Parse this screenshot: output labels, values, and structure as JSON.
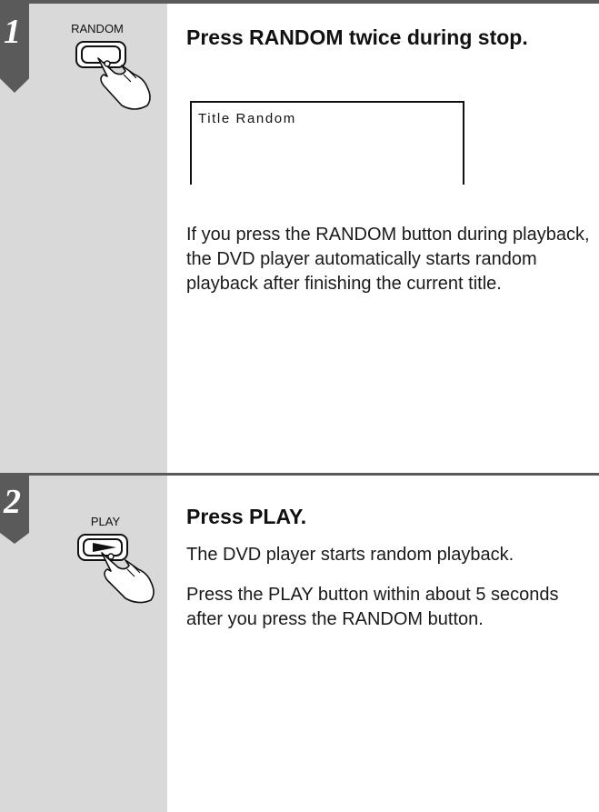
{
  "step1": {
    "number": "1",
    "button_label": "RANDOM",
    "heading": "Press RANDOM twice during stop.",
    "display_text": "Title Random",
    "body": "If you press the RANDOM button during playback, the DVD player automatically starts random playback after finishing the current title."
  },
  "step2": {
    "number": "2",
    "button_label": "PLAY",
    "heading": "Press PLAY.",
    "body1": "The DVD player starts random playback.",
    "body2": "Press the PLAY button within about 5 seconds after you press the RANDOM button."
  },
  "colors": {
    "sidebar": "#d9d9d9",
    "rule": "#5a5a5a",
    "tab": "#5a5a5a"
  },
  "icons": [
    "hand-pressing-button-icon",
    "play-arrow-icon"
  ]
}
